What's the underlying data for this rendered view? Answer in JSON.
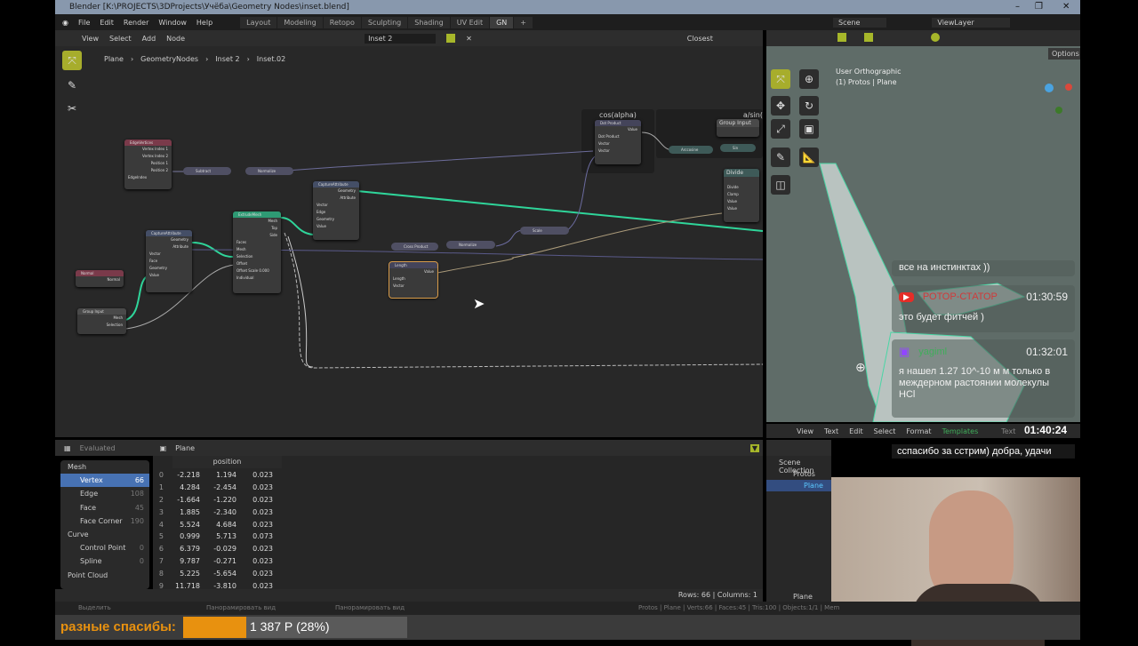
{
  "window": {
    "title": "Blender [K:\\PROJECTS\\3DProjects\\Учёба\\Geometry Nodes\\inset.blend]",
    "minimize": "–",
    "maximize": "❐",
    "close": "✕"
  },
  "menu": [
    "File",
    "Edit",
    "Render",
    "Window",
    "Help"
  ],
  "workspaces": [
    "Layout",
    "Modeling",
    "Retopo",
    "Sculpting",
    "Shading",
    "UV Edit",
    "GN",
    "+"
  ],
  "scene": {
    "label": "Scene",
    "viewlayer": "ViewLayer"
  },
  "node_editor": {
    "menu": [
      "View",
      "Select",
      "Add",
      "Node"
    ],
    "tree_name": "Inset 2",
    "snap": "Closest",
    "breadcrumbs": [
      "Plane",
      "GeometryNodes",
      "Inset 2",
      "Inset.02"
    ],
    "frames": [
      "cos(alpha)",
      "a/sin("
    ],
    "nodes": {
      "edge_vertices": {
        "title": "EdgeVertices",
        "rows": [
          "Vertex Index 1",
          "Vertex Index 2",
          "Position 1",
          "Position 2",
          "EdgeIndex"
        ]
      },
      "subtract": "Subtract",
      "normalize": "Normalize",
      "normalize2": "Normalize",
      "cross": "Cross Product",
      "scale": "Scale",
      "capture1": {
        "title": "CaptureAttribute",
        "rows": [
          "Geometry",
          "Attribute",
          "Vector",
          "Face",
          "Geometry",
          "Value"
        ]
      },
      "capture2": {
        "title": "CaptureAttribute",
        "rows": [
          "Geometry",
          "Attribute",
          "Vector",
          "Edge",
          "Geometry",
          "Value"
        ]
      },
      "extrude": {
        "title": "ExtrudeMesh",
        "rows": [
          "Mesh",
          "Top",
          "Side",
          "Faces",
          "Mesh",
          "Selection",
          "Offset",
          "Offset Scale 0.000",
          "Individual"
        ]
      },
      "normal": {
        "title": "Normal",
        "rows": [
          "Normal"
        ]
      },
      "group_input": {
        "title": "Group Input",
        "rows": [
          "Mesh",
          "Selection"
        ]
      },
      "length": {
        "title": "Length",
        "rows": [
          "Value",
          "Length",
          "Vector"
        ]
      },
      "dot": {
        "title": "Dot Product",
        "rows": [
          "Value",
          "Dot Product",
          "Vector",
          "Vector"
        ]
      },
      "arccos": "Arccosine",
      "sin": "Sin",
      "group_input2": "Group Input",
      "divide": {
        "title": "Divide",
        "rows": [
          "Divide",
          "Clamp",
          "Value",
          "Value"
        ]
      }
    }
  },
  "spreadsheet": {
    "mode": "Evaluated",
    "object": "Plane",
    "column": "position",
    "tree": [
      {
        "label": "Mesh",
        "count": ""
      },
      {
        "label": "Vertex",
        "count": "66",
        "selected": true
      },
      {
        "label": "Edge",
        "count": "108"
      },
      {
        "label": "Face",
        "count": "45"
      },
      {
        "label": "Face Corner",
        "count": "190"
      },
      {
        "label": "Curve",
        "count": ""
      },
      {
        "label": "Control Point",
        "count": "0"
      },
      {
        "label": "Spline",
        "count": "0"
      },
      {
        "label": "Point Cloud",
        "count": ""
      }
    ],
    "rows": [
      [
        "0",
        "-2.218",
        "1.194",
        "0.023"
      ],
      [
        "1",
        "4.284",
        "-2.454",
        "0.023"
      ],
      [
        "2",
        "-1.664",
        "-1.220",
        "0.023"
      ],
      [
        "3",
        "1.885",
        "-2.340",
        "0.023"
      ],
      [
        "4",
        "5.524",
        "4.684",
        "0.023"
      ],
      [
        "5",
        "0.999",
        "5.713",
        "0.073"
      ],
      [
        "6",
        "6.379",
        "-0.029",
        "0.023"
      ],
      [
        "7",
        "9.787",
        "-0.271",
        "0.023"
      ],
      [
        "8",
        "5.225",
        "-5.654",
        "0.023"
      ],
      [
        "9",
        "11.718",
        "-3.810",
        "0.023"
      ]
    ],
    "footer": "Rows: 66   |   Columns: 1"
  },
  "viewport": {
    "view": "User Orthographic",
    "object": "(1) Protos | Plane",
    "options": "Options"
  },
  "text_editor": {
    "menu": [
      "View",
      "Text",
      "Edit",
      "Select",
      "Format",
      "Templates"
    ],
    "name": "Text"
  },
  "outliner": {
    "items": [
      "Scene Collection",
      "Protos",
      "Plane"
    ],
    "footer_object": "Plane"
  },
  "status": {
    "left": [
      "Выделить",
      "Панорамировать вид",
      "Панорамировать вид"
    ],
    "right": "Protos | Plane | Verts:66 | Faces:45 | Tris:100 | Objects:1/1 | Mem"
  },
  "stream_overlay": {
    "chat": [
      {
        "text": "все на инстинктах ))"
      },
      {
        "platform": "youtube",
        "user": "РОТОР-СТАТОР",
        "time": "01:30:59",
        "text": "это будет фитчей )"
      },
      {
        "platform": "twitch",
        "user": "yagiml",
        "time": "01:32:01",
        "text": "я нашел 1.27 10^-10 м м только в междерном растоянии молекулы HCl"
      }
    ],
    "clock": "01:40:24",
    "last_message": "сспасибо за сстрим) добра, удачи",
    "donation_label": "разные спасибы:",
    "donation_text": "1 387 Р (28%)",
    "donation_progress": 0.28,
    "colors": {
      "accent": "#e8910f",
      "youtube": "#e52d27",
      "twitch": "#9146ff",
      "wire_green": "#2fd59a"
    }
  }
}
